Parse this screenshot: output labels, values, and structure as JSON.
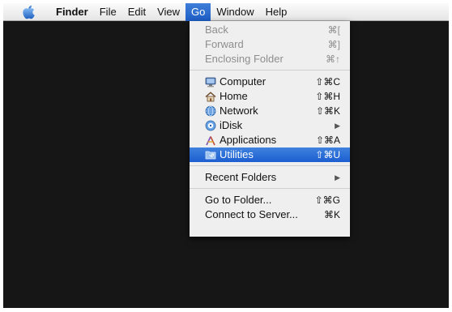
{
  "menubar": {
    "items": [
      {
        "label": "Finder"
      },
      {
        "label": "File"
      },
      {
        "label": "Edit"
      },
      {
        "label": "View"
      },
      {
        "label": "Go"
      },
      {
        "label": "Window"
      },
      {
        "label": "Help"
      }
    ]
  },
  "go_menu": {
    "items": [
      {
        "label": "Back",
        "shortcut": "⌘[",
        "enabled": false
      },
      {
        "label": "Forward",
        "shortcut": "⌘]",
        "enabled": false
      },
      {
        "label": "Enclosing Folder",
        "shortcut": "⌘↑",
        "enabled": false
      },
      {
        "label": "Computer",
        "shortcut": "⇧⌘C",
        "icon": "computer-icon"
      },
      {
        "label": "Home",
        "shortcut": "⇧⌘H",
        "icon": "home-icon"
      },
      {
        "label": "Network",
        "shortcut": "⇧⌘K",
        "icon": "network-icon"
      },
      {
        "label": "iDisk",
        "shortcut": "▶",
        "icon": "idisk-icon"
      },
      {
        "label": "Applications",
        "shortcut": "⇧⌘A",
        "icon": "applications-icon"
      },
      {
        "label": "Utilities",
        "shortcut": "⇧⌘U",
        "icon": "utilities-folder-icon",
        "highlighted": true
      },
      {
        "label": "Recent Folders",
        "shortcut": "▶"
      },
      {
        "label": "Go to Folder...",
        "shortcut": "⇧⌘G"
      },
      {
        "label": "Connect to Server...",
        "shortcut": "⌘K"
      }
    ]
  },
  "colors": {
    "highlight": "#1c5ed0",
    "desktop": "#161616"
  }
}
